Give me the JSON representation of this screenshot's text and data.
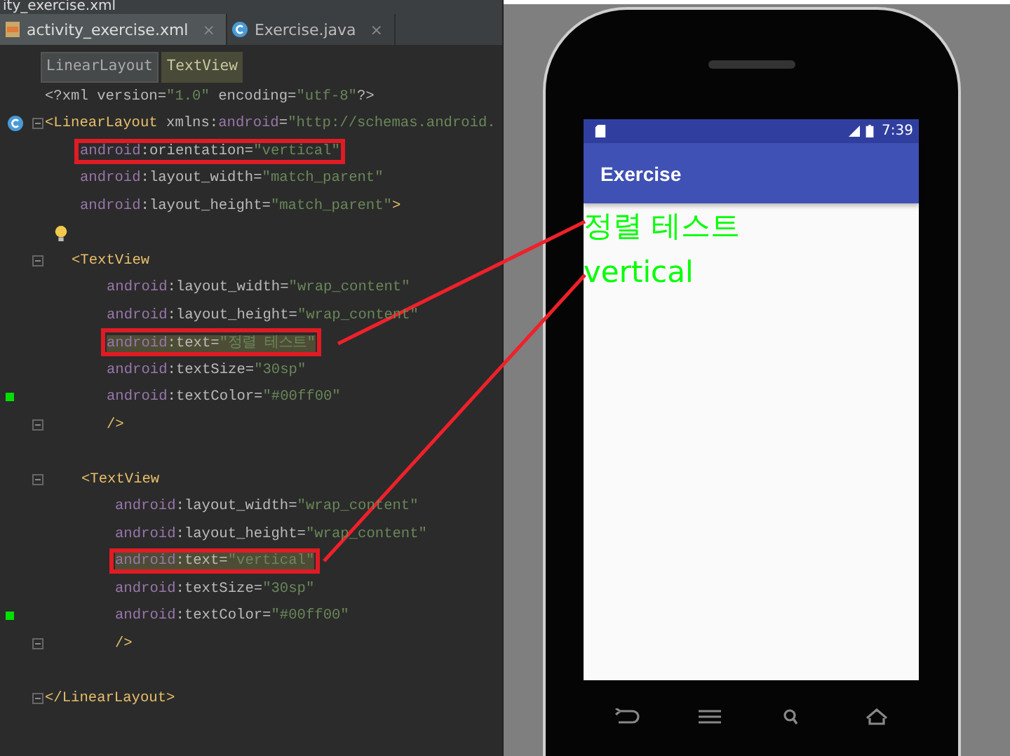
{
  "editor": {
    "path": "ity_exercise.xml",
    "tabs": [
      {
        "label": "activity_exercise.xml",
        "selected": true,
        "close": "×"
      },
      {
        "label": "Exercise.java",
        "selected": false,
        "close": "×"
      }
    ],
    "breadcrumbs": [
      {
        "label": "LinearLayout",
        "selected": false
      },
      {
        "label": "TextView",
        "selected": true
      }
    ],
    "lines": [
      {
        "kind": "top",
        "tokens": [
          {
            "kind": "text",
            "text": "<?xml version="
          },
          {
            "kind": "value",
            "text": "\"1.0\""
          },
          {
            "kind": "text",
            "text": " encoding="
          },
          {
            "kind": "value",
            "text": "\"utf-8\""
          },
          {
            "kind": "text",
            "text": "?>"
          }
        ],
        "boxed": false,
        "highlighted": false,
        "fold": false
      },
      {
        "kind": "top",
        "tokens": [
          {
            "kind": "tag",
            "text": "<LinearLayout"
          },
          {
            "kind": "text",
            "text": " xmlns:"
          },
          {
            "kind": "ns",
            "text": "android"
          },
          {
            "kind": "text",
            "text": "="
          },
          {
            "kind": "value",
            "text": "\"http://schemas.android."
          }
        ],
        "boxed": false,
        "highlighted": false,
        "fold": true
      },
      {
        "kind": "attr",
        "tokens": [
          {
            "kind": "ns",
            "text": "android"
          },
          {
            "kind": "text",
            "text": ":orientation="
          },
          {
            "kind": "value",
            "text": "\"vertical\""
          }
        ],
        "boxed": true,
        "highlighted": false,
        "fold": false
      },
      {
        "kind": "attr",
        "tokens": [
          {
            "kind": "ns",
            "text": "android"
          },
          {
            "kind": "text",
            "text": ":layout_width="
          },
          {
            "kind": "value",
            "text": "\"match_parent\""
          }
        ],
        "boxed": false,
        "highlighted": false,
        "fold": false
      },
      {
        "kind": "attr",
        "tokens": [
          {
            "kind": "ns",
            "text": "android"
          },
          {
            "kind": "text",
            "text": ":layout_height="
          },
          {
            "kind": "value",
            "text": "\"match_parent\""
          },
          {
            "kind": "tag",
            "text": ">"
          }
        ],
        "boxed": false,
        "highlighted": false,
        "fold": false
      },
      {
        "kind": "blank"
      },
      {
        "kind": "child",
        "tokens": [
          {
            "kind": "tag",
            "text": "<TextView"
          }
        ],
        "boxed": false,
        "highlighted": false,
        "fold": true
      },
      {
        "kind": "child-attr",
        "tokens": [
          {
            "kind": "ns",
            "text": "android"
          },
          {
            "kind": "text",
            "text": ":layout_width="
          },
          {
            "kind": "value",
            "text": "\"wrap_content\""
          }
        ],
        "boxed": false,
        "highlighted": false,
        "fold": false
      },
      {
        "kind": "child-attr",
        "tokens": [
          {
            "kind": "ns",
            "text": "android"
          },
          {
            "kind": "text",
            "text": ":layout_height="
          },
          {
            "kind": "value",
            "text": "\"wrap_content\""
          }
        ],
        "boxed": false,
        "highlighted": false,
        "fold": false
      },
      {
        "kind": "child-attr",
        "tokens": [
          {
            "kind": "ns",
            "text": "android"
          },
          {
            "kind": "text",
            "text": ":text="
          },
          {
            "kind": "value",
            "text": "\"정렬 테스트\""
          }
        ],
        "boxed": true,
        "highlighted": true,
        "fold": false
      },
      {
        "kind": "child-attr",
        "tokens": [
          {
            "kind": "ns",
            "text": "android"
          },
          {
            "kind": "text",
            "text": ":textSize="
          },
          {
            "kind": "value",
            "text": "\"30sp\""
          }
        ],
        "boxed": false,
        "highlighted": false,
        "fold": false
      },
      {
        "kind": "child-attr",
        "tokens": [
          {
            "kind": "ns",
            "text": "android"
          },
          {
            "kind": "text",
            "text": ":textColor="
          },
          {
            "kind": "value",
            "text": "\"#00ff00\""
          }
        ],
        "boxed": false,
        "highlighted": false,
        "fold": false
      },
      {
        "kind": "child-attr",
        "tokens": [
          {
            "kind": "tag",
            "text": "/>"
          }
        ],
        "boxed": false,
        "highlighted": false,
        "fold": true
      },
      {
        "kind": "blank"
      },
      {
        "kind": "child2",
        "tokens": [
          {
            "kind": "tag",
            "text": "<TextView"
          }
        ],
        "boxed": false,
        "highlighted": false,
        "fold": true
      },
      {
        "kind": "child2-attr",
        "tokens": [
          {
            "kind": "ns",
            "text": "android"
          },
          {
            "kind": "text",
            "text": ":layout_width="
          },
          {
            "kind": "value",
            "text": "\"wrap_content\""
          }
        ],
        "boxed": false,
        "highlighted": false,
        "fold": false
      },
      {
        "kind": "child2-attr",
        "tokens": [
          {
            "kind": "ns",
            "text": "android"
          },
          {
            "kind": "text",
            "text": ":layout_height="
          },
          {
            "kind": "value",
            "text": "\"wrap_content\""
          }
        ],
        "boxed": false,
        "highlighted": false,
        "fold": false
      },
      {
        "kind": "child2-attr",
        "tokens": [
          {
            "kind": "ns",
            "text": "android"
          },
          {
            "kind": "text",
            "text": ":text="
          },
          {
            "kind": "value",
            "text": "\"vertical\""
          }
        ],
        "boxed": true,
        "highlighted": true,
        "fold": false
      },
      {
        "kind": "child2-attr",
        "tokens": [
          {
            "kind": "ns",
            "text": "android"
          },
          {
            "kind": "text",
            "text": ":textSize="
          },
          {
            "kind": "value",
            "text": "\"30sp\""
          }
        ],
        "boxed": false,
        "highlighted": false,
        "fold": false
      },
      {
        "kind": "child2-attr",
        "tokens": [
          {
            "kind": "ns",
            "text": "android"
          },
          {
            "kind": "text",
            "text": ":textColor="
          },
          {
            "kind": "value",
            "text": "\"#00ff00\""
          }
        ],
        "boxed": false,
        "highlighted": false,
        "fold": false
      },
      {
        "kind": "child2-attr",
        "tokens": [
          {
            "kind": "tag",
            "text": "/>"
          }
        ],
        "boxed": false,
        "highlighted": false,
        "fold": true
      },
      {
        "kind": "blank"
      },
      {
        "kind": "top",
        "tokens": [
          {
            "kind": "tag",
            "text": "</LinearLayout>"
          }
        ],
        "boxed": false,
        "highlighted": false,
        "fold": true
      }
    ]
  },
  "phone": {
    "time": "7:39",
    "app_title": "Exercise",
    "texts": [
      "정렬 테스트",
      "vertical"
    ]
  }
}
